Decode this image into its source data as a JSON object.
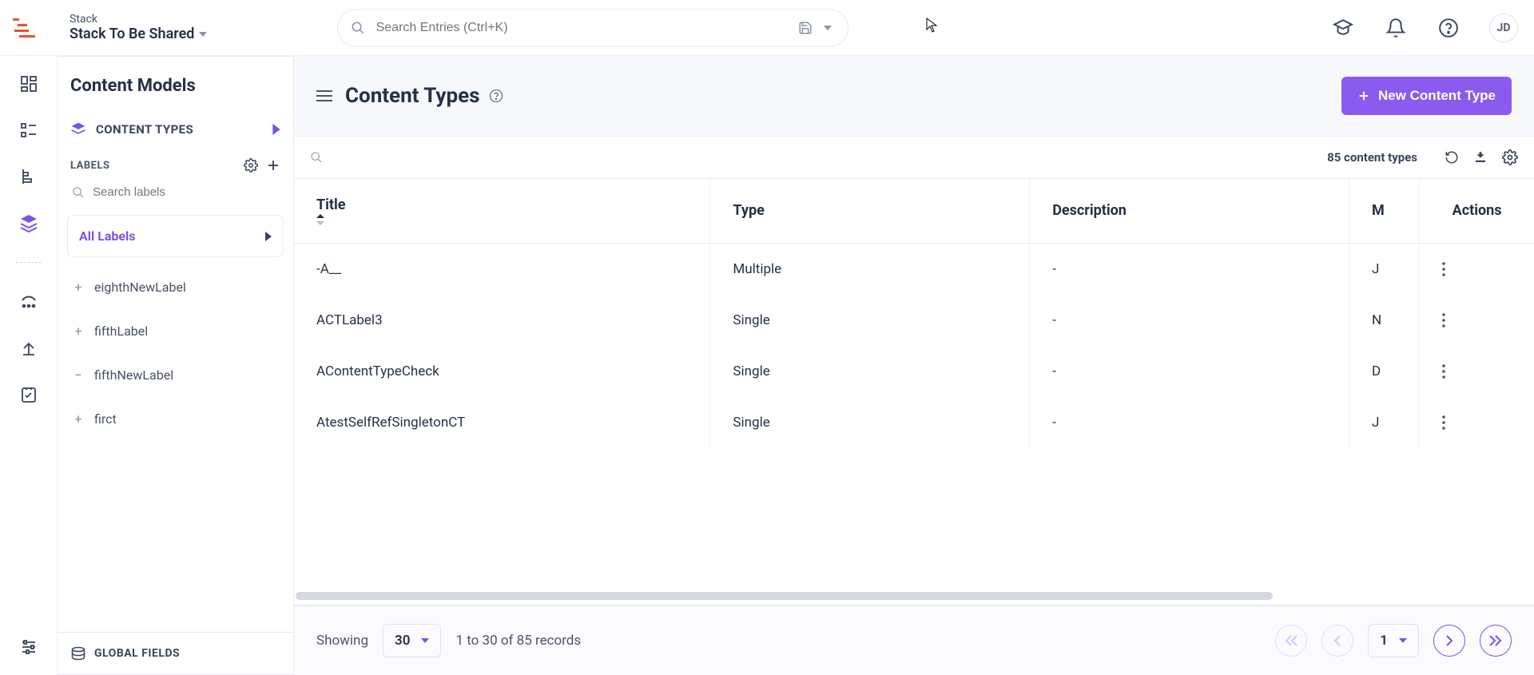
{
  "header": {
    "stack_label": "Stack",
    "stack_name": "Stack To Be Shared",
    "search_placeholder": "Search Entries (Ctrl+K)",
    "avatar_initials": "JD"
  },
  "sidebar": {
    "title": "Content Models",
    "content_types_label": "CONTENT TYPES",
    "labels_heading": "LABELS",
    "search_labels_placeholder": "Search labels",
    "all_labels_label": "All Labels",
    "labels": [
      {
        "glyph": "+",
        "name": "eighthNewLabel"
      },
      {
        "glyph": "+",
        "name": "fifthLabel"
      },
      {
        "glyph": "−",
        "name": "fifthNewLabel"
      },
      {
        "glyph": "+",
        "name": "firct"
      }
    ],
    "global_fields_label": "GLOBAL FIELDS"
  },
  "main": {
    "page_title": "Content Types",
    "new_button": "New Content Type",
    "count_text": "85 content types",
    "columns": {
      "title": "Title",
      "type": "Type",
      "description": "Description",
      "m": "M",
      "actions": "Actions"
    },
    "rows": [
      {
        "title": "-A__",
        "type": "Multiple",
        "description": "-",
        "m": "J"
      },
      {
        "title": "ACTLabel3",
        "type": "Single",
        "description": "-",
        "m": "N"
      },
      {
        "title": "AContentTypeCheck",
        "type": "Single",
        "description": "-",
        "m": "D"
      },
      {
        "title": "AtestSelfRefSingletonCT",
        "type": "Single",
        "description": "-",
        "m": "J"
      }
    ]
  },
  "footer": {
    "showing": "Showing",
    "page_size": "30",
    "records_text": "1 to 30 of 85 records",
    "current_page": "1"
  }
}
